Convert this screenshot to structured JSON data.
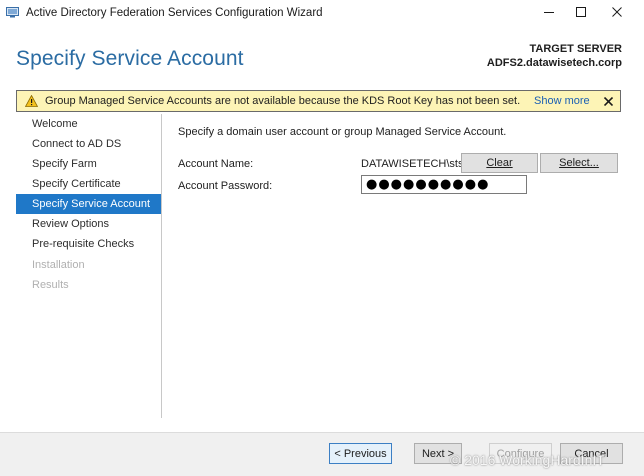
{
  "window": {
    "title": "Active Directory Federation Services Configuration Wizard",
    "icons": {
      "app": "adfs-wizard-icon",
      "minimize": "minimize-icon",
      "maximize": "maximize-icon",
      "close": "close-icon"
    }
  },
  "header": {
    "title": "Specify Service Account",
    "target_server_label": "TARGET SERVER",
    "target_server_value": "ADFS2.datawisetech.corp"
  },
  "warning": {
    "text": "Group Managed Service Accounts are not available because the KDS Root Key has not been set. Use the foll...",
    "show_more": "Show more",
    "icon": "warning-icon",
    "color": "#fdf4b6"
  },
  "nav": {
    "items": [
      {
        "label": "Welcome",
        "state": "normal"
      },
      {
        "label": "Connect to AD DS",
        "state": "normal"
      },
      {
        "label": "Specify Farm",
        "state": "normal"
      },
      {
        "label": "Specify Certificate",
        "state": "normal"
      },
      {
        "label": "Specify Service Account",
        "state": "active"
      },
      {
        "label": "Review Options",
        "state": "normal"
      },
      {
        "label": "Pre-requisite Checks",
        "state": "normal"
      },
      {
        "label": "Installation",
        "state": "disabled"
      },
      {
        "label": "Results",
        "state": "disabled"
      }
    ],
    "active_color": "#1f78c8"
  },
  "content": {
    "intro": "Specify a domain user account or group Managed Service Account.",
    "account_name_label": "Account Name:",
    "account_name_value": "DATAWISETECH\\sts...",
    "clear_button": "Clear",
    "select_button": "Select...",
    "account_password_label": "Account Password:",
    "account_password_value": "●●●●●●●●●●"
  },
  "footer": {
    "previous_button": "< Previous",
    "next_button": "Next >",
    "configure_button": "Configure",
    "cancel_button": "Cancel"
  },
  "watermark": "© 2016 WorkingHardInIT"
}
